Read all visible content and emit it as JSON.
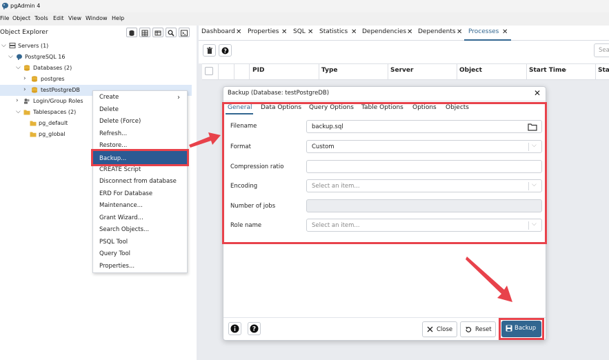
{
  "app": {
    "title": "pgAdmin 4"
  },
  "menu": [
    "File",
    "Object",
    "Tools",
    "Edit",
    "View",
    "Window",
    "Help"
  ],
  "object_explorer": {
    "title": "Object Explorer",
    "tree": [
      {
        "label": "Servers (1)"
      },
      {
        "label": "PostgreSQL 16"
      },
      {
        "label": "Databases (2)"
      },
      {
        "label": "postgres"
      },
      {
        "label": "testPostgreDB"
      },
      {
        "label": "Login/Group Roles"
      },
      {
        "label": "Tablespaces (2)"
      },
      {
        "label": "pg_default"
      },
      {
        "label": "pg_global"
      }
    ]
  },
  "context_menu": {
    "items": [
      "Create",
      "Delete",
      "Delete (Force)",
      "Refresh...",
      "Restore...",
      "Backup...",
      "CREATE Script",
      "Disconnect from database",
      "ERD For Database",
      "Maintenance...",
      "Grant Wizard...",
      "Search Objects...",
      "PSQL Tool",
      "Query Tool",
      "Properties..."
    ]
  },
  "main_tabs": [
    "Dashboard",
    "Properties",
    "SQL",
    "Statistics",
    "Dependencies",
    "Dependents",
    "Processes"
  ],
  "active_tab": "Processes",
  "search": {
    "placeholder": "Sea"
  },
  "grid": {
    "columns": [
      "PID",
      "Type",
      "Server",
      "Object",
      "Start Time",
      "Stat"
    ]
  },
  "dialog": {
    "title": "Backup (Database: testPostgreDB)",
    "tabs": [
      "General",
      "Data Options",
      "Query Options",
      "Table Options",
      "Options",
      "Objects"
    ],
    "fields": {
      "filename": {
        "label": "Filename",
        "value": "backup.sql"
      },
      "format": {
        "label": "Format",
        "value": "Custom"
      },
      "compression": {
        "label": "Compression ratio",
        "value": ""
      },
      "encoding": {
        "label": "Encoding",
        "placeholder": "Select an item..."
      },
      "jobs": {
        "label": "Number of jobs",
        "value": ""
      },
      "role": {
        "label": "Role name",
        "placeholder": "Select an item..."
      }
    },
    "buttons": {
      "close": "Close",
      "reset": "Reset",
      "backup": "Backup"
    }
  },
  "colors": {
    "accent": "#326690",
    "highlight_red": "#e8424b",
    "selection": "#2b5a93"
  }
}
